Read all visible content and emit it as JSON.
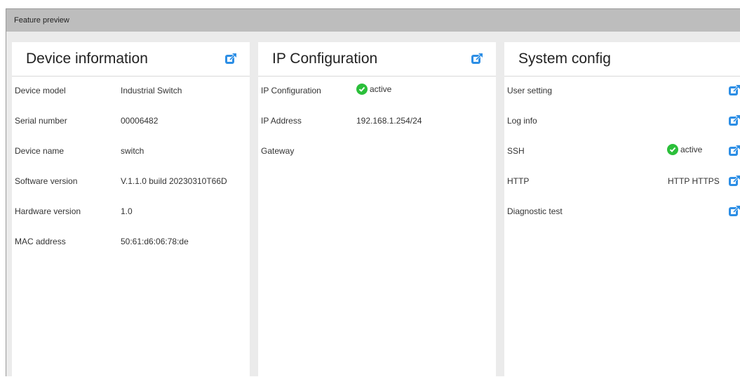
{
  "window": {
    "title": "Feature preview"
  },
  "colors": {
    "accent": "#2c8ee5",
    "status_ok": "#2bbf3a",
    "titlebar": "#bdbdbd"
  },
  "device": {
    "title": "Device information",
    "rows": [
      {
        "label": "Device model",
        "value": "Industrial Switch"
      },
      {
        "label": "Serial number",
        "value": "00006482"
      },
      {
        "label": "Device name",
        "value": "switch"
      },
      {
        "label": "Software version",
        "value": "V.1.1.0 build 20230310T66D"
      },
      {
        "label": "Hardware version",
        "value": "1.0"
      },
      {
        "label": "MAC address",
        "value": "50:61:d6:06:78:de"
      }
    ]
  },
  "ip": {
    "title": "IP Configuration",
    "rows": [
      {
        "label": "IP Configuration",
        "status": "active"
      },
      {
        "label": "IP Address",
        "value": "192.168.1.254/24"
      },
      {
        "label": "Gateway",
        "value": ""
      }
    ]
  },
  "system": {
    "title": "System config",
    "rows": [
      {
        "label": "User setting",
        "value": ""
      },
      {
        "label": "Log info",
        "value": ""
      },
      {
        "label": "SSH",
        "status": "active"
      },
      {
        "label": "HTTP",
        "value": "HTTP HTTPS"
      },
      {
        "label": "Diagnostic test",
        "value": ""
      }
    ]
  },
  "icons": {
    "edit": "external-edit-icon",
    "check": "check-circle-icon"
  }
}
